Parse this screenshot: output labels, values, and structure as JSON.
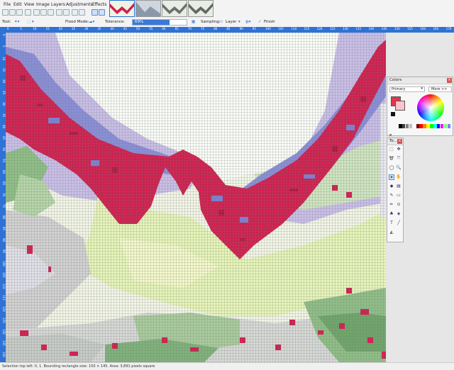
{
  "menu": {
    "items": [
      "File",
      "Edit",
      "View",
      "Image",
      "Layers",
      "Adjustments",
      "Effects"
    ]
  },
  "toolbar": {
    "tool_label": "Tool:",
    "flood_mode_label": "Flood Mode:",
    "tolerance_label": "Tolerance:",
    "tolerance_value": "69%",
    "tolerance_fraction": 0.69,
    "sampling_label": "Sampling:",
    "layer_label": "Layer",
    "finish_label": "Finish"
  },
  "ruler": {
    "h_ticks": [
      "0",
      "5",
      "10",
      "15",
      "20",
      "25",
      "30",
      "35",
      "40",
      "45",
      "50",
      "55",
      "60",
      "65",
      "70",
      "75",
      "80",
      "85",
      "90",
      "95",
      "100",
      "105",
      "110",
      "115",
      "120",
      "125",
      "130",
      "135",
      "140",
      "145",
      "150",
      "155",
      "160",
      "165",
      "170"
    ],
    "v_ticks": [
      "0",
      "5",
      "10",
      "15",
      "20",
      "25",
      "30",
      "35",
      "40",
      "45",
      "50",
      "55",
      "60",
      "65",
      "70",
      "75",
      "80",
      "85",
      "90",
      "95",
      "100",
      "105",
      "110",
      "115",
      "120",
      "125",
      "130",
      "135",
      "140"
    ]
  },
  "colors_panel": {
    "title": "Colors",
    "mode": "Primary",
    "more_button": "More >>",
    "primary_color": "#e8344f",
    "palette": [
      "#000000",
      "#404040",
      "#808080",
      "#c0c0c0",
      "#ffffff",
      "#7f0000",
      "#ff0000",
      "#ff8000",
      "#ffff00",
      "#00ff00",
      "#00ffff",
      "#0000ff",
      "#ff00ff",
      "#80ff80",
      "#8080ff"
    ]
  },
  "tools_panel": {
    "title": "To...",
    "icons": [
      "rectangle-select-icon",
      "move-icon",
      "lasso-icon",
      "move-selection-icon",
      "ellipse-select-icon",
      "zoom-icon",
      "magic-wand-icon",
      "pan-icon",
      "paint-bucket-icon",
      "gradient-icon",
      "paintbrush-icon",
      "eraser-icon",
      "pencil-icon",
      "color-picker-icon",
      "clone-stamp-icon",
      "recolor-icon",
      "text-icon",
      "line-icon",
      "shapes-icon"
    ]
  },
  "status": {
    "text": "Selection top left: 0, 1. Bounding rectangle size: 150 × 145. Area: 3,891 pixels square"
  },
  "colors": {
    "ruler_blue": "#2f72d6",
    "magenta": "#d0204f",
    "lavender": "#c9bfe8",
    "periwinkle": "#8a8fd8",
    "lime": "#e6f5b8",
    "pale_green": "#cfe5c0",
    "green": "#8fbf86",
    "light_gray": "#d2d2d2"
  }
}
